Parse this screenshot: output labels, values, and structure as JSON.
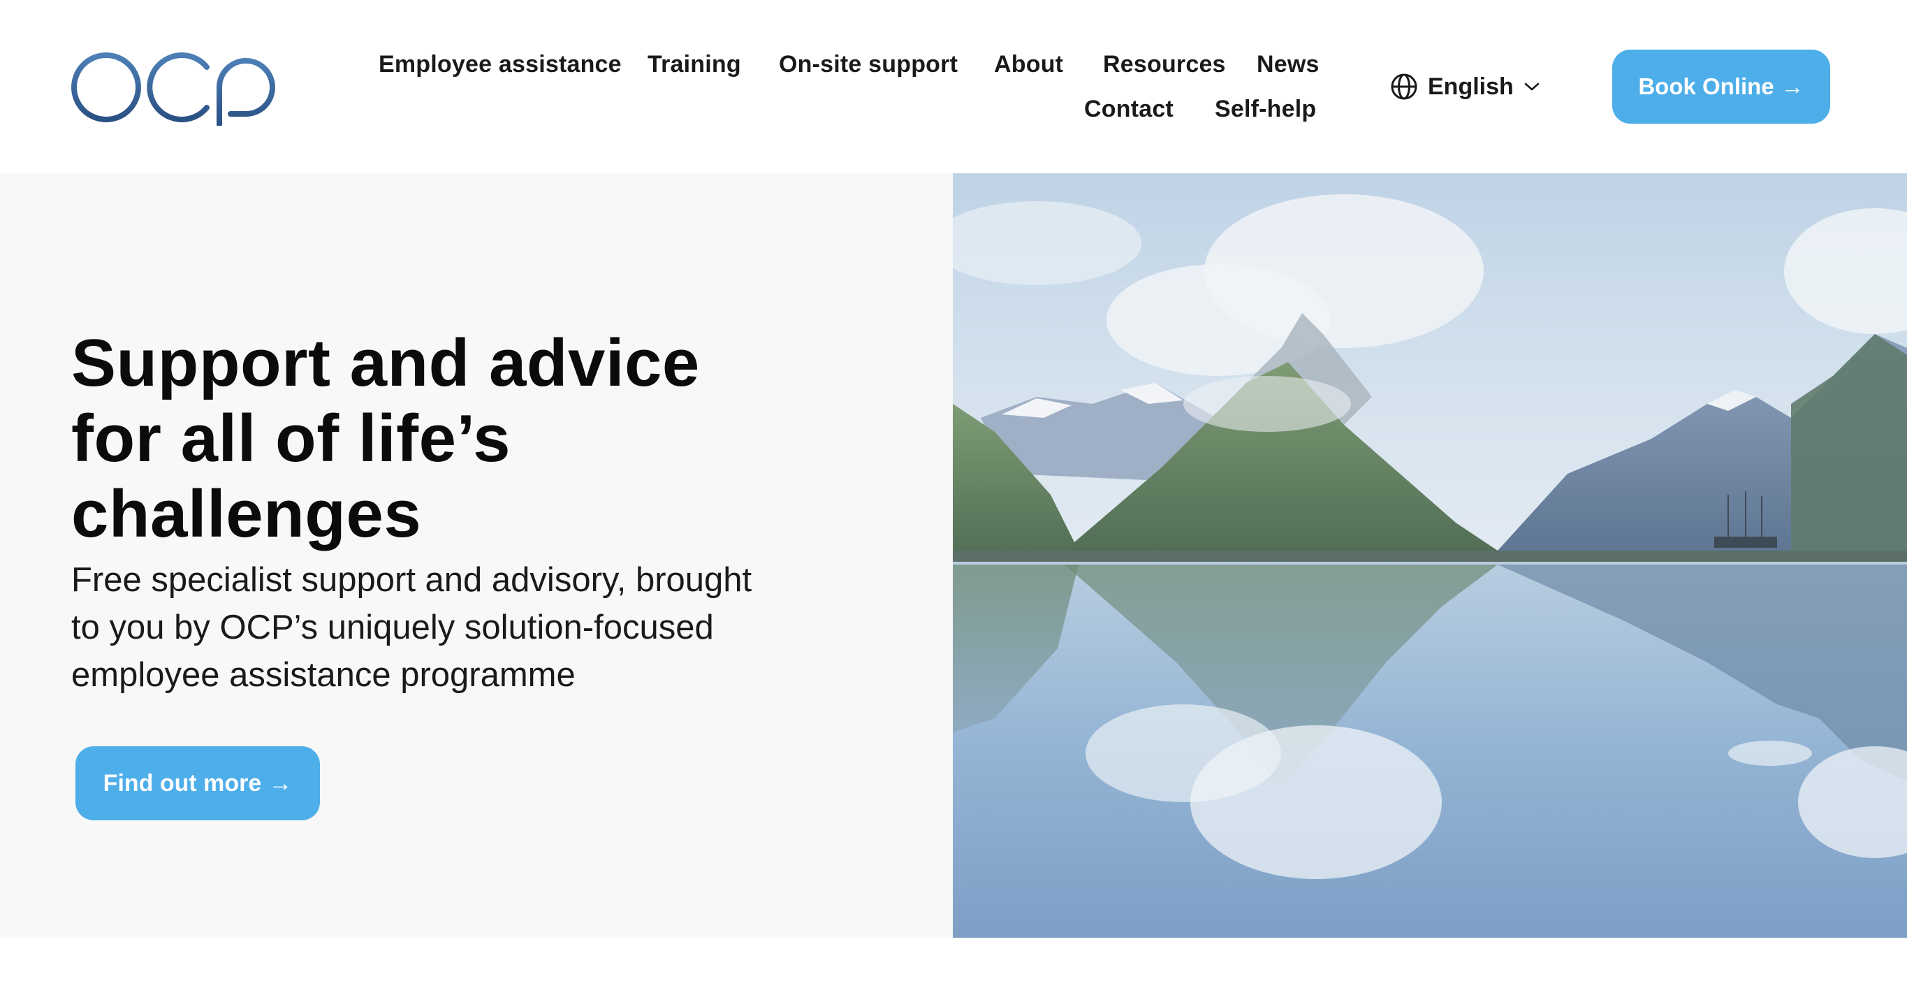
{
  "brand": {
    "logo_text": "OCP",
    "logo_color": "#2f5d92",
    "accent": "#4daee9"
  },
  "nav": {
    "items": [
      {
        "label": "Employee assistance"
      },
      {
        "label": "Training"
      },
      {
        "label": "On-site support"
      },
      {
        "label": "About"
      },
      {
        "label": "Resources"
      },
      {
        "label": "News"
      },
      {
        "label": "Contact"
      },
      {
        "label": "Self-help"
      }
    ]
  },
  "language": {
    "icon": "globe-icon",
    "label": "English",
    "chevron": "chevron-down-icon"
  },
  "header_cta": {
    "label": "Book Online",
    "arrow": "→"
  },
  "hero": {
    "title_lines": [
      "Support and advice",
      "for all of life’s",
      "challenges"
    ],
    "subtitle_lines": [
      "Free specialist support and advisory, brought",
      "to you by OCP’s uniquely solution-focused",
      "employee assistance programme"
    ],
    "cta": {
      "label": "Find out more",
      "arrow": "→"
    },
    "image": "mountain-lake-landscape"
  }
}
